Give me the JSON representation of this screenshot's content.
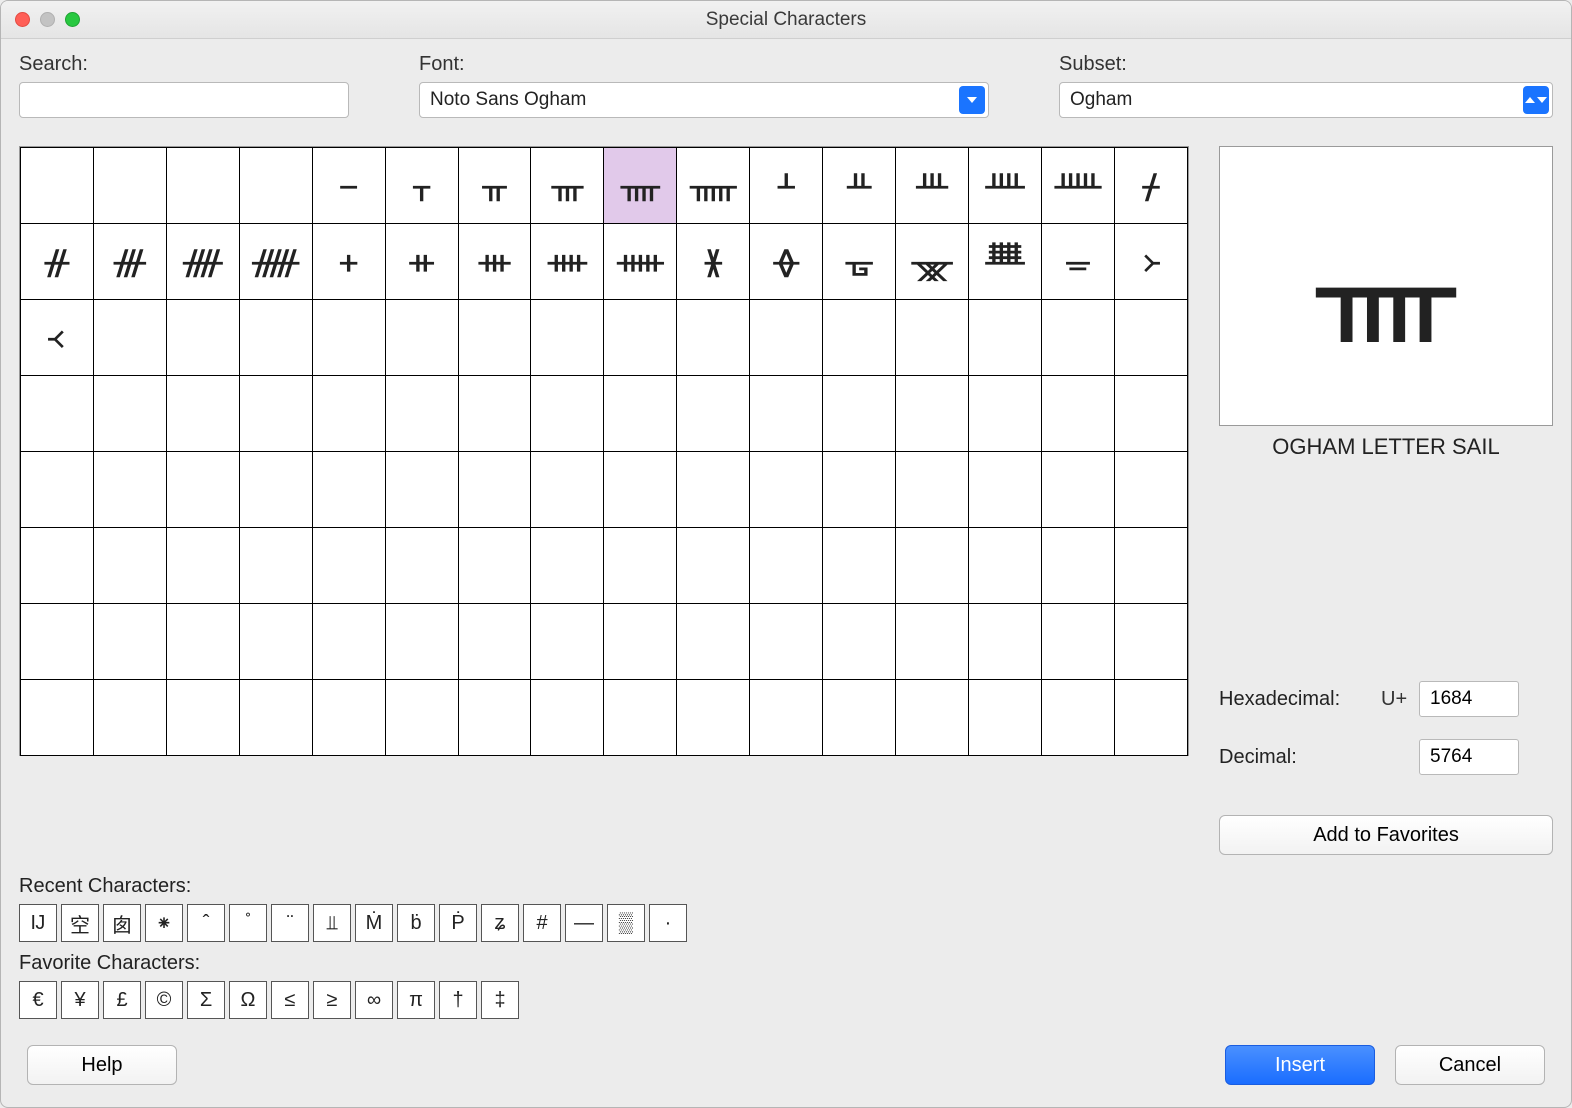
{
  "window": {
    "title": "Special Characters"
  },
  "search": {
    "label": "Search:",
    "value": ""
  },
  "font": {
    "label": "Font:",
    "value": "Noto Sans Ogham"
  },
  "subset": {
    "label": "Subset:",
    "value": "Ogham"
  },
  "grid": {
    "rows": [
      [
        "",
        "",
        "",
        "",
        " ",
        "ᚁ",
        "ᚂ",
        "ᚃ",
        "ᚄ",
        "ᚅ",
        "ᚆ",
        "ᚇ",
        "ᚈ",
        "ᚉ",
        "ᚊ",
        "ᚋ"
      ],
      [
        "ᚌ",
        "ᚍ",
        "ᚎ",
        "ᚏ",
        "ᚐ",
        "ᚑ",
        "ᚒ",
        "ᚓ",
        "ᚔ",
        "ᚕ",
        "ᚖ",
        "ᚗ",
        "ᚘ",
        "ᚙ",
        "ᚚ",
        "᚛"
      ],
      [
        "᚜",
        "",
        "",
        "",
        "",
        "",
        "",
        "",
        "",
        "",
        "",
        "",
        "",
        "",
        "",
        ""
      ],
      [
        "",
        "",
        "",
        "",
        "",
        "",
        "",
        "",
        "",
        "",
        "",
        "",
        "",
        "",
        "",
        ""
      ],
      [
        "",
        "",
        "",
        "",
        "",
        "",
        "",
        "",
        "",
        "",
        "",
        "",
        "",
        "",
        "",
        ""
      ],
      [
        "",
        "",
        "",
        "",
        "",
        "",
        "",
        "",
        "",
        "",
        "",
        "",
        "",
        "",
        "",
        ""
      ],
      [
        "",
        "",
        "",
        "",
        "",
        "",
        "",
        "",
        "",
        "",
        "",
        "",
        "",
        "",
        "",
        ""
      ],
      [
        "",
        "",
        "",
        "",
        "",
        "",
        "",
        "",
        "",
        "",
        "",
        "",
        "",
        "",
        "",
        ""
      ]
    ],
    "selected": {
      "row": 0,
      "col": 8
    }
  },
  "preview": {
    "glyph": "ᚄ",
    "name": "OGHAM LETTER SAIL"
  },
  "info": {
    "hex_label": "Hexadecimal:",
    "hex_prefix": "U+",
    "hex_value": "1684",
    "dec_label": "Decimal:",
    "dec_value": "5764"
  },
  "buttons": {
    "add_fav": "Add to Favorites",
    "help": "Help",
    "insert": "Insert",
    "cancel": "Cancel"
  },
  "recent": {
    "label": "Recent Characters:",
    "items": [
      "Ĳ",
      "空",
      "囱",
      "⁕",
      "̂",
      "̊",
      "̈",
      "⫫",
      "Ṁ",
      "ḃ",
      "Ṗ",
      "ʑ",
      "#",
      "—",
      "▒",
      "·"
    ]
  },
  "favorites": {
    "label": "Favorite Characters:",
    "items": [
      "€",
      "¥",
      "£",
      "©",
      "Σ",
      "Ω",
      "≤",
      "≥",
      "∞",
      "π",
      "†",
      "‡"
    ]
  }
}
